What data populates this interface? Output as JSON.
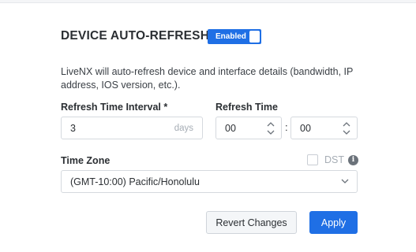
{
  "section": {
    "title": "DEVICE AUTO-REFRESH",
    "toggle_label": "Enabled",
    "description": "LiveNX will auto-refresh device and interface details (bandwidth, IP address, IOS version, etc.)."
  },
  "refresh_interval": {
    "label": "Refresh Time Interval *",
    "value": "3",
    "unit": "days"
  },
  "refresh_time": {
    "label": "Refresh Time",
    "hours": "00",
    "minutes": "00",
    "separator": ":"
  },
  "timezone": {
    "label": "Time Zone",
    "value": "(GMT-10:00) Pacific/Honolulu",
    "dst_label": "DST",
    "dst_checked": false
  },
  "buttons": {
    "revert": "Revert Changes",
    "apply": "Apply"
  },
  "colors": {
    "accent": "#1f6fe5"
  }
}
